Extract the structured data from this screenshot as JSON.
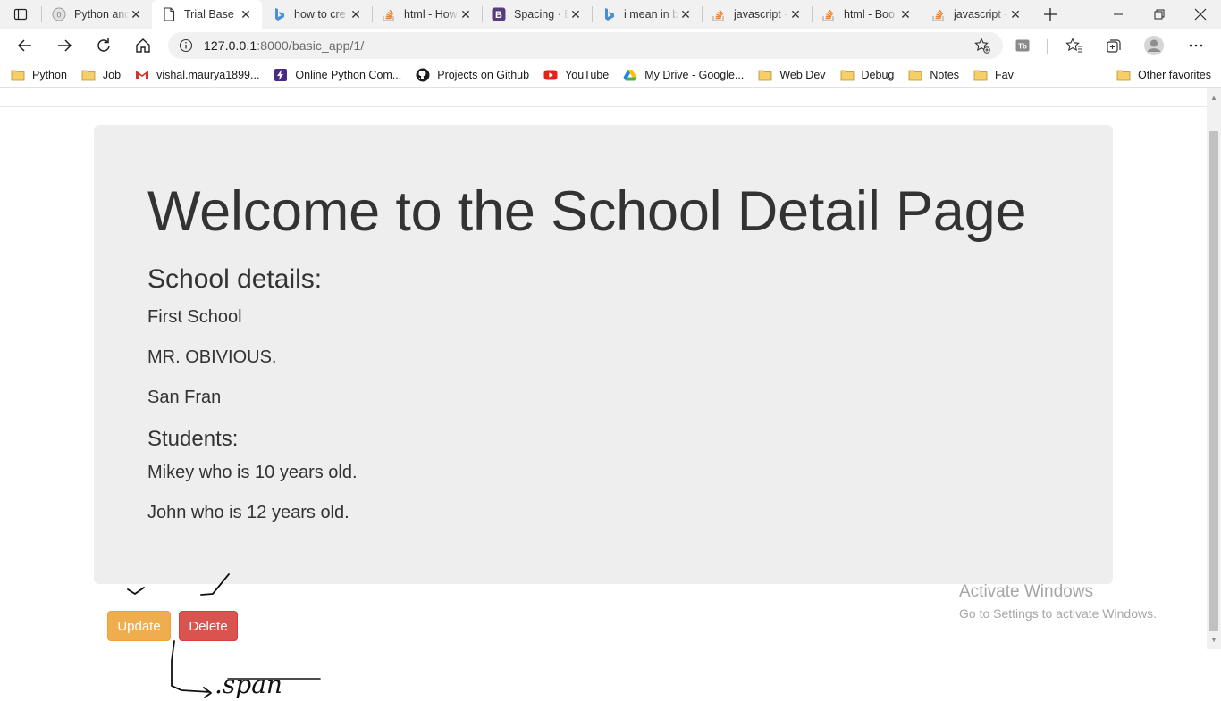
{
  "browser": {
    "tabs": [
      {
        "title": "Python and",
        "icon": "generic-favicon-icon",
        "active": false
      },
      {
        "title": "Trial Base",
        "icon": "document-icon",
        "active": true
      },
      {
        "title": "how to cre",
        "icon": "bing-icon",
        "active": false
      },
      {
        "title": "html - How",
        "icon": "stackoverflow-icon",
        "active": false
      },
      {
        "title": "Spacing · B",
        "icon": "bootstrap-icon",
        "active": false
      },
      {
        "title": "i mean in b",
        "icon": "bing-icon",
        "active": false
      },
      {
        "title": "javascript -",
        "icon": "stackoverflow-icon",
        "active": false
      },
      {
        "title": "html - Boo",
        "icon": "stackoverflow-icon",
        "active": false
      },
      {
        "title": "javascript -",
        "icon": "stackoverflow-icon",
        "active": false
      }
    ],
    "close_glyph": "✕",
    "url_host": "127.0.0.1",
    "url_rest": ":8000/basic_app/1/",
    "bookmarks": [
      {
        "label": "Python",
        "icon": "folder-icon"
      },
      {
        "label": "Job",
        "icon": "folder-icon"
      },
      {
        "label": "vishal.maurya1899...",
        "icon": "gmail-icon"
      },
      {
        "label": "Online Python Com...",
        "icon": "lightning-icon"
      },
      {
        "label": "Projects on Github",
        "icon": "github-icon"
      },
      {
        "label": "YouTube",
        "icon": "youtube-icon"
      },
      {
        "label": "My Drive - Google...",
        "icon": "google-drive-icon"
      },
      {
        "label": "Web Dev",
        "icon": "folder-icon"
      },
      {
        "label": "Debug",
        "icon": "folder-icon"
      },
      {
        "label": "Notes",
        "icon": "folder-icon"
      },
      {
        "label": "Fav",
        "icon": "folder-icon"
      }
    ],
    "other_favorites": "Other favorites"
  },
  "page": {
    "heading": "Welcome to the School Detail Page",
    "school_details_heading": "School details:",
    "school_name": "First School",
    "principal": "MR. OBIVIOUS.",
    "location": "San Fran",
    "students_heading": "Students:",
    "students": [
      "Mikey who is 10 years old.",
      "John who is 12 years old."
    ],
    "update_label": "Update",
    "delete_label": "Delete"
  },
  "windows_watermark": {
    "line1": "Activate Windows",
    "line2": "Go to Settings to activate Windows."
  },
  "annotation_text": ".span",
  "colors": {
    "warning": "#f0ad4e",
    "danger": "#d9534f",
    "jumbotron_bg": "#eeeeee"
  }
}
